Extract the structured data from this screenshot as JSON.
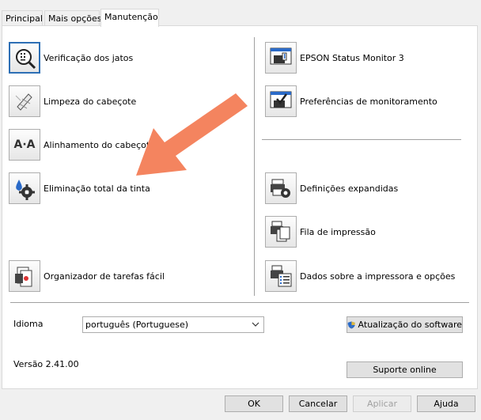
{
  "tabs": [
    {
      "label": "Principal"
    },
    {
      "label": "Mais opções"
    },
    {
      "label": "Manutenção"
    }
  ],
  "left_items": [
    {
      "label": "Verificação dos jatos",
      "icon": "nozzle-check-icon"
    },
    {
      "label": "Limpeza do cabeçote",
      "icon": "head-cleaning-icon"
    },
    {
      "label": "Alinhamento do cabeçote",
      "icon": "head-alignment-icon"
    },
    {
      "label": "Eliminação total da tinta",
      "icon": "ink-flush-icon"
    },
    {
      "label": "Organizador de tarefas fácil",
      "icon": "job-arranger-icon"
    }
  ],
  "right_items": [
    {
      "label": "EPSON Status Monitor 3",
      "icon": "status-monitor-icon"
    },
    {
      "label": "Preferências de monitoramento",
      "icon": "monitoring-preferences-icon"
    },
    {
      "label": "Definições expandidas",
      "icon": "extended-settings-icon"
    },
    {
      "label": "Fila de impressão",
      "icon": "print-queue-icon"
    },
    {
      "label": "Dados sobre a impressora e opções",
      "icon": "printer-info-icon"
    }
  ],
  "icon_glyph_text": "A·A",
  "language": {
    "label": "Idioma",
    "selected": "português (Portuguese)"
  },
  "software_update_button": "Atualização do software",
  "version": "Versão 2.41.00",
  "online_support_button": "Suporte online",
  "footer": {
    "ok": "OK",
    "cancel": "Cancelar",
    "apply": "Aplicar",
    "help": "Ajuda"
  },
  "colors": {
    "annotation_arrow": "#f4845f",
    "focus_border": "#2d6fb5",
    "shield_blue": "#2a6ac8",
    "shield_yellow": "#f2c230"
  }
}
